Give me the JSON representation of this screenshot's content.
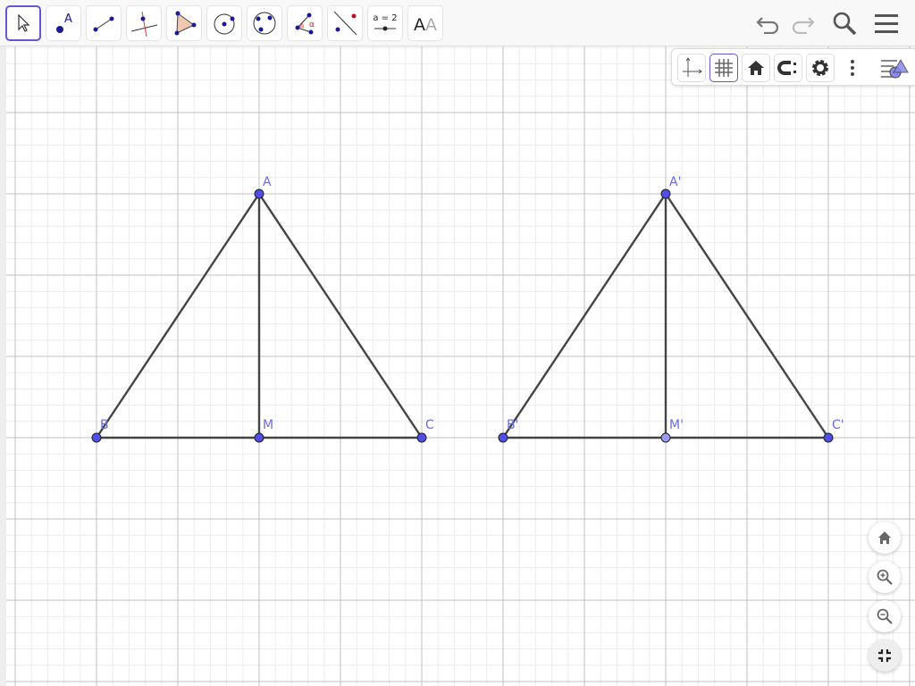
{
  "toolbar": {
    "tools": [
      {
        "name": "move-tool"
      },
      {
        "name": "point-tool",
        "label": "A"
      },
      {
        "name": "segment-tool"
      },
      {
        "name": "perpendicular-line-tool"
      },
      {
        "name": "polygon-tool"
      },
      {
        "name": "circle-tool"
      },
      {
        "name": "circle-three-points-tool"
      },
      {
        "name": "angle-tool",
        "label": "α"
      },
      {
        "name": "reflect-tool"
      },
      {
        "name": "slider-tool",
        "label": "a = 2"
      },
      {
        "name": "text-tool",
        "label": "A"
      }
    ]
  },
  "points": {
    "A": "A",
    "B": "B",
    "M": "M",
    "C": "C",
    "A2": "A'",
    "B2": "B'",
    "M2": "M'",
    "C2": "C'"
  },
  "colors": {
    "point": "#4f4fe8",
    "point_light": "#9a9af0",
    "segment": "#444444",
    "accent": "#6557d2"
  }
}
